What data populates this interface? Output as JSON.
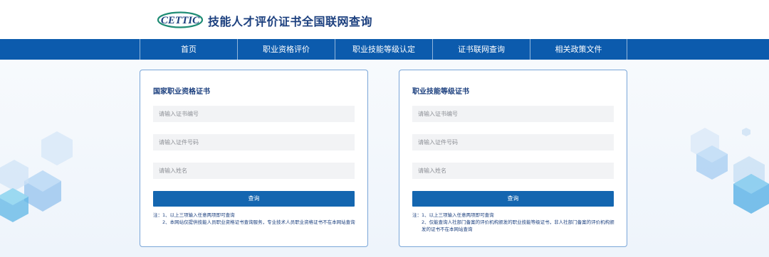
{
  "header": {
    "logo_text": "CETTIC",
    "title": "技能人才评价证书全国联网查询"
  },
  "nav": {
    "items": [
      {
        "label": "首页"
      },
      {
        "label": "职业资格评价"
      },
      {
        "label": "职业技能等级认定"
      },
      {
        "label": "证书联网查询"
      },
      {
        "label": "相关政策文件"
      }
    ]
  },
  "cards": [
    {
      "title": "国家职业资格证书",
      "cert_placeholder": "请输入证书编号",
      "id_placeholder": "请输入证件号码",
      "name_placeholder": "请输入姓名",
      "button_label": "查询",
      "note_1": "注：1、以上三项输入任意两项即可查询",
      "note_2": "2、本网站仅提供技能人员职业资格证书查询服务，专业技术人员职业资格证书不在本网站查询"
    },
    {
      "title": "职业技能等级证书",
      "cert_placeholder": "请输入证书编号",
      "id_placeholder": "请输入证件号码",
      "name_placeholder": "请输入姓名",
      "button_label": "查询",
      "note_1": "注：1、以上三项输入任意两项即可查询",
      "note_2": "2、仅能查询人社部门备案的评价机构颁发的职业技能等级证书，非人社部门备案的评价机构颁发的证书不在本网站查询"
    }
  ],
  "colors": {
    "nav_bg": "#0c5bad",
    "title": "#1b3f7e",
    "button": "#1466b0",
    "card_border": "#7aa6d8"
  }
}
